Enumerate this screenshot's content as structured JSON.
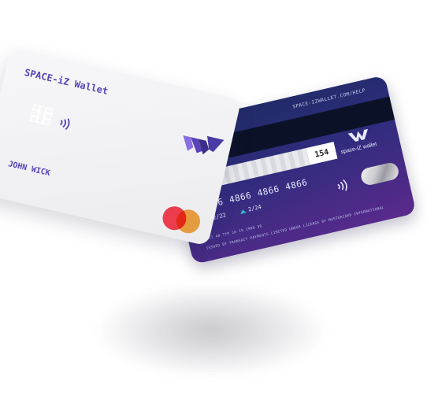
{
  "front_card": {
    "title": "SPACE-iZ Wallet",
    "cardholder": "JOHN WICK",
    "logo_icon": "space-iz-logo-icon",
    "chip_icon": "chip-icon",
    "nfc_icon": "contactless-icon",
    "network": "mastercard-logo"
  },
  "back_card": {
    "url": "SPACE-IZWALLET.COM/HELP",
    "cvv": "154",
    "brand": "space-iZ wallet",
    "number_groups": [
      "4866",
      "4866",
      "4866",
      "4866"
    ],
    "expiry_1": "2/22",
    "expiry_2": "2/24",
    "fine_print_1": "CRST 40 TYP 1A 19 190B 38",
    "fine_print_2": "ISSUED BY TRANSACT PAYMENTS LIMITED UNDER LICENSE BY MASTERCARD INTERNATIONAL",
    "hologram": "hologram-icon"
  },
  "colors": {
    "brand_purple": "#5a43b8",
    "card_navy": "#1e2b63",
    "card_violet": "#5a2a8c",
    "mastercard_red": "#eb3d4d",
    "mastercard_orange": "#f7a033"
  }
}
